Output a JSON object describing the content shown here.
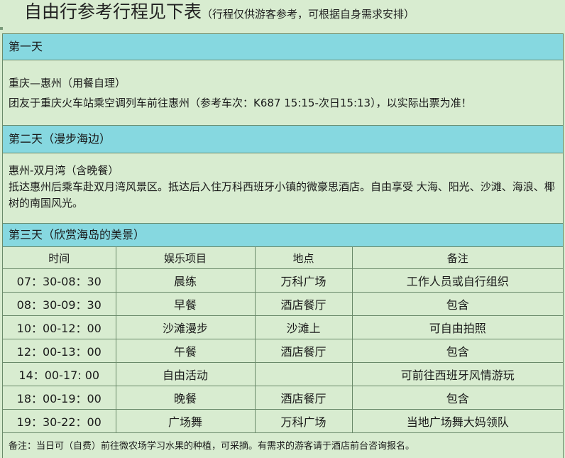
{
  "header": {
    "title": "自由行参考行程见下表",
    "subtitle": "（行程仅供游客参考，可根据自身需求安排）"
  },
  "day1": {
    "heading": "第一天",
    "route": "重庆—惠州（用餐自理）",
    "detail": "团友于重庆火车站乘空调列车前往惠州（参考车次：K687  15:15-次日15:13），以实际出票为准！"
  },
  "day2": {
    "heading": "第二天（漫步海边）",
    "route": "惠州-双月湾（含晚餐）",
    "detail": "抵达惠州后乘车赴双月湾风景区。抵达后入住万科西班牙小镇的微豪思酒店。自由享受 大海、阳光、沙滩、海浪、椰树的南国风光。"
  },
  "day3": {
    "heading": "第三天（欣赏海岛的美景）",
    "columns": [
      "时间",
      "娱乐项目",
      "地点",
      "备注"
    ],
    "rows": [
      {
        "time": "07：30-08：30",
        "activity": "晨练",
        "place": "万科广场",
        "remark": "工作人员或自行组织"
      },
      {
        "time": "08：30-09：30",
        "activity": "早餐",
        "place": "酒店餐厅",
        "remark": "包含"
      },
      {
        "time": "10：00-12：00",
        "activity": "沙滩漫步",
        "place": "沙滩上",
        "remark": "可自由拍照"
      },
      {
        "time": "12：00-13：00",
        "activity": "午餐",
        "place": "酒店餐厅",
        "remark": "包含"
      },
      {
        "time": "14：00-17: 00",
        "activity": "自由活动",
        "place": "",
        "remark": "可前往西班牙风情游玩"
      },
      {
        "time": "18：00-19：00",
        "activity": "晚餐",
        "place": "酒店餐厅",
        "remark": "包含"
      },
      {
        "time": "19：30-22：00",
        "activity": "广场舞",
        "place": "万科广场",
        "remark": "当地广场舞大妈领队"
      }
    ],
    "note": "备注：当日可（自费）前往微农场学习水果的种植，可采摘。有需求的游客请于酒店前台咨询报名。"
  }
}
